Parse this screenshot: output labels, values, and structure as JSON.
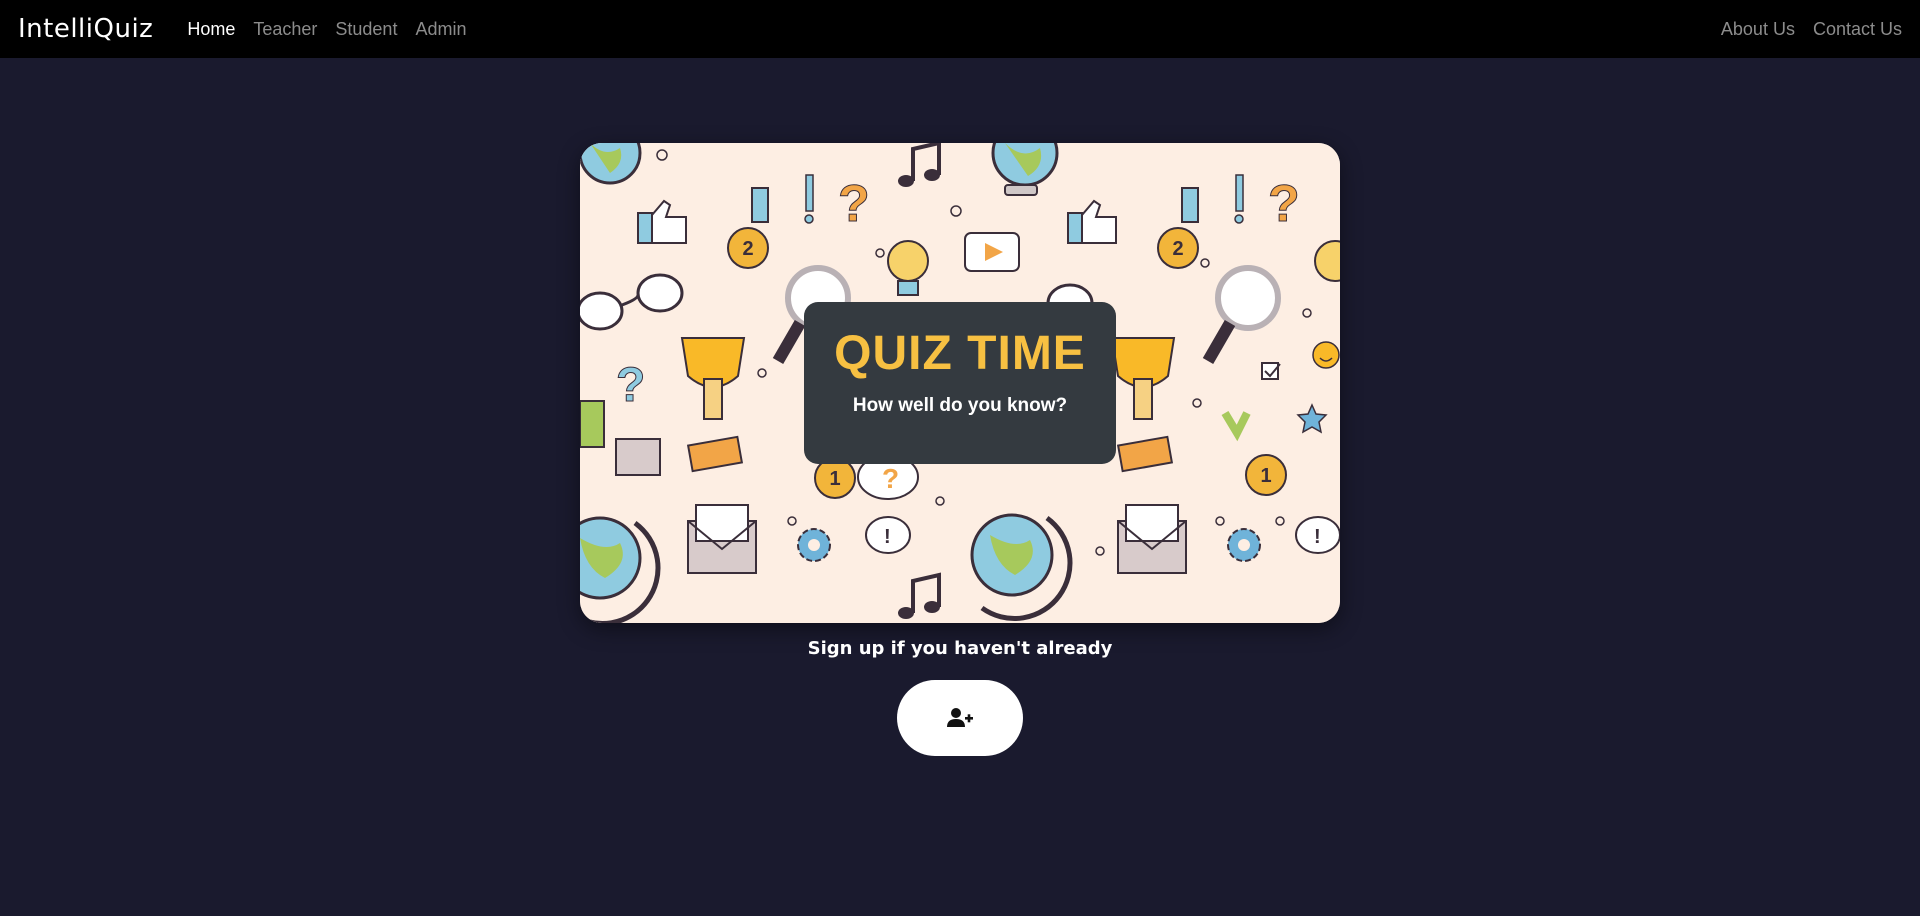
{
  "nav": {
    "brand": "IntelliQuiz",
    "left_links": [
      "Home",
      "Teacher",
      "Student",
      "Admin"
    ],
    "active": "Home",
    "right_links": [
      "About Us",
      "Contact Us"
    ]
  },
  "hero": {
    "title": "QUIZ TIME",
    "subtitle": "How well do you know?",
    "background_icons": [
      "globe-icon",
      "thumbs-up-icon",
      "medal-icon",
      "question-mark-icon",
      "exclamation-icon",
      "music-note-icon",
      "lightbulb-icon",
      "play-icon",
      "glasses-icon",
      "magnifier-icon",
      "trophy-icon",
      "puzzle-icon",
      "envelope-icon",
      "gear-icon",
      "speech-bubble-icon",
      "star-icon",
      "smiley-icon",
      "checkbox-icon"
    ],
    "medal_numbers": [
      "2",
      "1"
    ]
  },
  "signup": {
    "text": "Sign up if you haven't already",
    "button_icon": "user-plus-icon"
  },
  "colors": {
    "page_background": "#1a1a2e",
    "navbar": "#000000",
    "panel": "#343a40",
    "title": "#f7c042",
    "hero_background": "#fdeee3"
  }
}
